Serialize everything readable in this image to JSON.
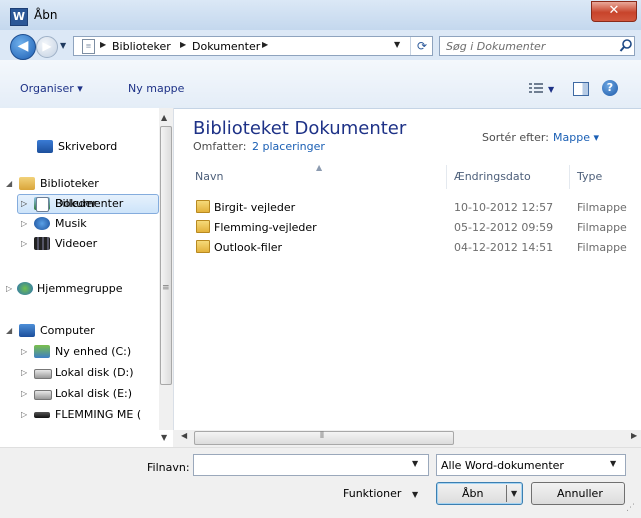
{
  "window": {
    "title": "Åbn",
    "app_icon": "W",
    "close_glyph": "✕"
  },
  "address": {
    "back_glyph": "◀",
    "forward_glyph": "▶",
    "breadcrumbs": [
      "Biblioteker",
      "Dokumenter"
    ],
    "search_placeholder": "Søg i Dokumenter"
  },
  "toolbar": {
    "organise_label": "Organiser ▾",
    "new_folder_label": "Ny mappe"
  },
  "nav": {
    "items": [
      {
        "label": "Skrivebord",
        "icon": "desktop-icon"
      },
      {
        "label": "Biblioteker",
        "icon": "libraries-icon"
      },
      {
        "label": "Billeder",
        "icon": "pictures-icon"
      },
      {
        "label": "Dokumenter",
        "icon": "documents-icon"
      },
      {
        "label": "Musik",
        "icon": "music-icon"
      },
      {
        "label": "Videoer",
        "icon": "videos-icon"
      },
      {
        "label": "Hjemmegruppe",
        "icon": "homegroup-icon"
      },
      {
        "label": "Computer",
        "icon": "computer-icon"
      },
      {
        "label": "Ny enhed (C:)",
        "icon": "drive-c-icon"
      },
      {
        "label": "Lokal disk (D:)",
        "icon": "drive-d-icon"
      },
      {
        "label": "Lokal disk (E:)",
        "icon": "drive-e-icon"
      },
      {
        "label": "FLEMMING ME (",
        "icon": "removable-drive-icon"
      }
    ]
  },
  "library": {
    "title": "Biblioteket Dokumenter",
    "includes_label": "Omfatter:",
    "locations_link": "2 placeringer",
    "sort_label": "Sortér efter:",
    "sort_value": "Mappe ▾"
  },
  "table": {
    "columns": [
      "Navn",
      "Ændringsdato",
      "Type"
    ],
    "rows": [
      {
        "name": "Birgit- vejleder",
        "date": "10-10-2012 12:57",
        "type": "Filmappe"
      },
      {
        "name": "Flemming-vejleder",
        "date": "05-12-2012 09:59",
        "type": "Filmappe"
      },
      {
        "name": "Outlook-filer",
        "date": "04-12-2012 14:51",
        "type": "Filmappe"
      }
    ]
  },
  "footer": {
    "filename_label": "Filnavn:",
    "filename_value": "",
    "filetype_value": "Alle Word-dokumenter",
    "tools_label": "Funktioner",
    "open_label": "Åbn",
    "cancel_label": "Annuller"
  },
  "colors": {
    "accent": "#1e3287",
    "link": "#1a5fb4",
    "selection": "#cde4fa"
  }
}
